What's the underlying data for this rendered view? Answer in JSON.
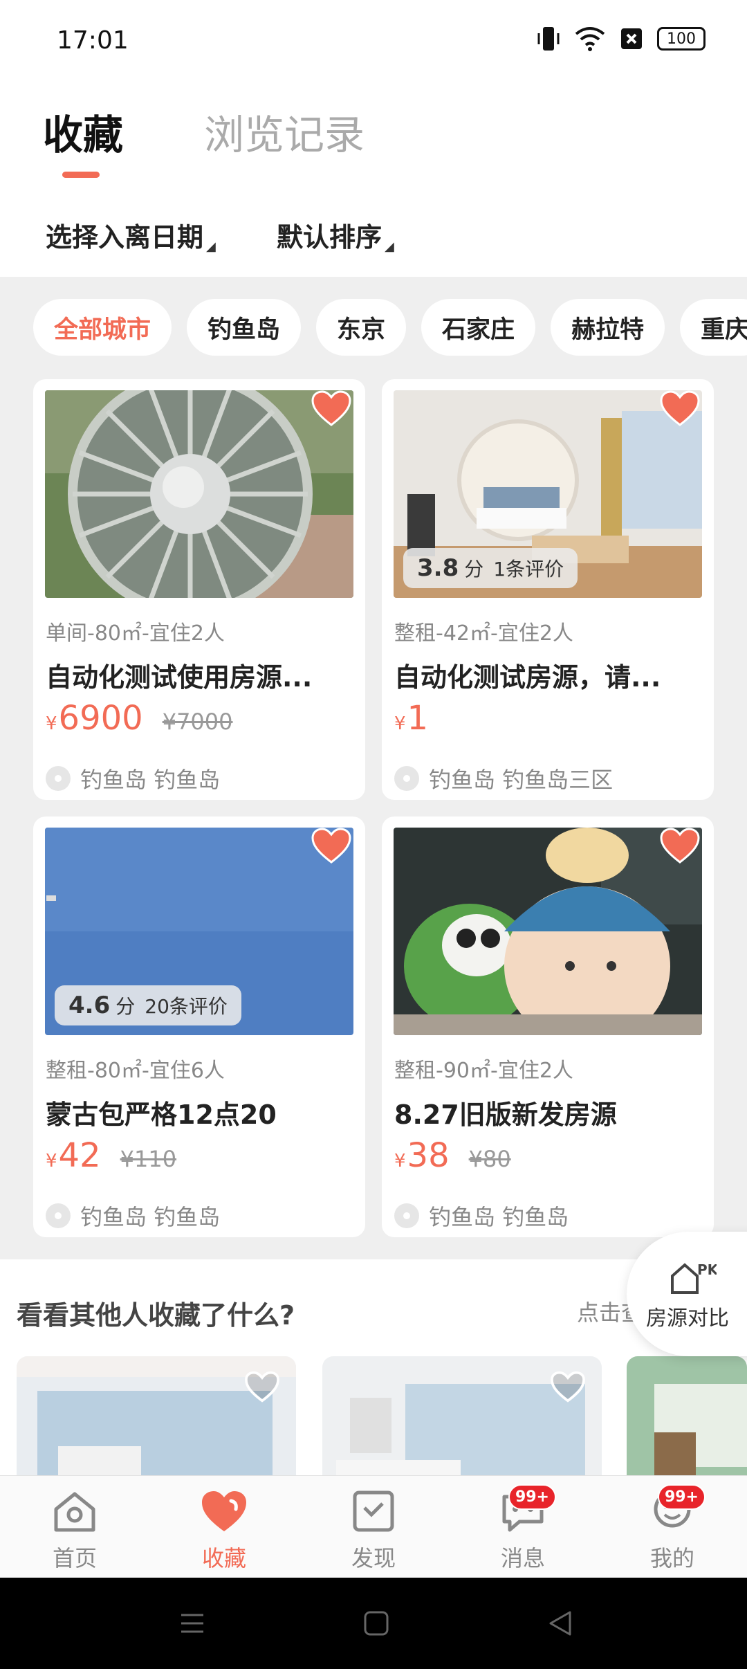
{
  "status": {
    "time": "17:01",
    "battery": "100"
  },
  "tabs": {
    "favorites": "收藏",
    "history": "浏览记录"
  },
  "filters": {
    "date": "选择入离日期",
    "sort": "默认排序"
  },
  "cities": [
    "全部城市",
    "钓鱼岛",
    "东京",
    "石家庄",
    "赫拉特",
    "重庆"
  ],
  "listings": [
    {
      "spec": "单间-80㎡-宜住2人",
      "title": "自动化测试使用房源...",
      "price": "6900",
      "original_price": "¥7000",
      "location": "钓鱼岛 钓鱼岛",
      "rating": null
    },
    {
      "spec": "整租-42㎡-宜住2人",
      "title": "自动化测试房源，请...",
      "price": "1",
      "original_price": "",
      "location": "钓鱼岛 钓鱼岛三区",
      "rating": {
        "score": "3.8",
        "unit": "分",
        "count": "1条评价"
      }
    },
    {
      "spec": "整租-80㎡-宜住6人",
      "title": "蒙古包严格12点20",
      "price": "42",
      "original_price": "¥110",
      "location": "钓鱼岛 钓鱼岛",
      "rating": {
        "score": "4.6",
        "unit": "分",
        "count": "20条评价"
      }
    },
    {
      "spec": "整租-90㎡-宜住2人",
      "title": "8.27旧版新发房源",
      "price": "38",
      "original_price": "¥80",
      "location": "钓鱼岛 钓鱼岛",
      "rating": null
    }
  ],
  "currency": "¥",
  "others": {
    "heading": "看看其他人收藏了什么?",
    "hint": "点击查看"
  },
  "compare": {
    "badge": "PK",
    "label": "房源对比"
  },
  "nav": [
    {
      "label": "首页",
      "badge": ""
    },
    {
      "label": "收藏",
      "badge": ""
    },
    {
      "label": "发现",
      "badge": ""
    },
    {
      "label": "消息",
      "badge": "99+"
    },
    {
      "label": "我的",
      "badge": "99+"
    }
  ],
  "colors": {
    "accent": "#f26b55",
    "badge": "#e8242a"
  }
}
